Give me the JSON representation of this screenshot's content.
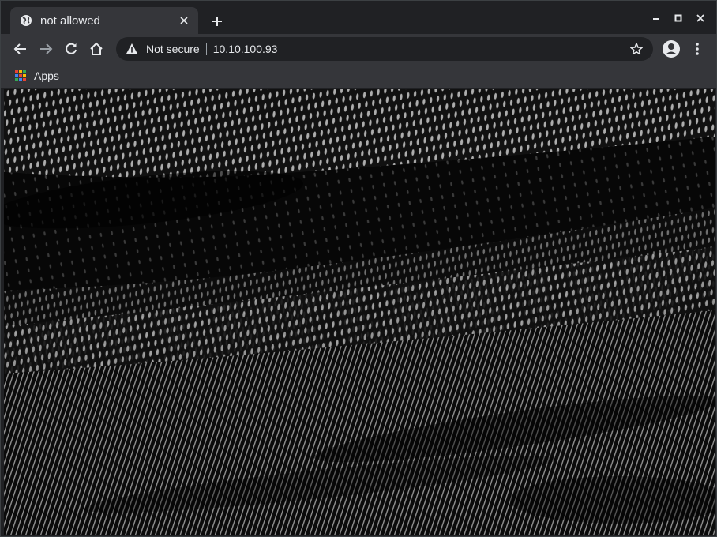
{
  "tab": {
    "title": "not allowed",
    "favicon": "globe-icon",
    "close_icon": "close-icon"
  },
  "new_tab_icon": "plus-icon",
  "window_controls": {
    "minimize": "minimize-icon",
    "maximize": "maximize-icon",
    "close": "close-icon"
  },
  "toolbar": {
    "back_icon": "arrow-left-icon",
    "forward_icon": "arrow-right-icon",
    "reload_icon": "reload-icon",
    "home_icon": "home-icon",
    "security_label": "Not secure",
    "security_icon": "warning-icon",
    "url": "10.10.100.93",
    "bookmark_icon": "star-icon",
    "profile_icon": "account-icon",
    "menu_icon": "kebab-menu-icon"
  },
  "bookmarks": {
    "apps_label": "Apps",
    "apps_icon": "apps-grid-icon"
  },
  "content": {
    "image": "dark-textured-fabric-photo"
  },
  "colors": {
    "frame": "#202124",
    "toolbar": "#35363a",
    "text": "#e8eaed",
    "icon": "#e8eaed",
    "icon_disabled": "#9aa0a6"
  }
}
